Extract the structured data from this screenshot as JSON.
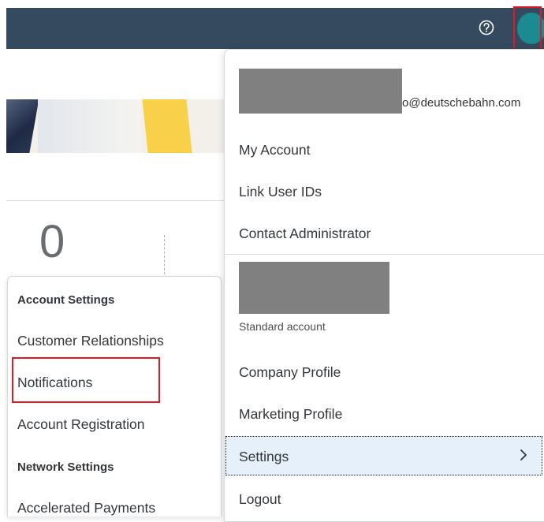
{
  "header": {
    "help_icon": "help-icon",
    "avatar_icon": "user-avatar"
  },
  "dashboard": {
    "count": "0"
  },
  "user_menu": {
    "email_suffix": "o@deutschebahn.com",
    "items_top": [
      "My Account",
      "Link User IDs",
      "Contact Administrator"
    ],
    "account_type": "Standard account",
    "items_bottom": [
      "Company Profile",
      "Marketing Profile",
      "Settings",
      "Logout"
    ],
    "settings_chevron": "chevron-right-icon"
  },
  "settings_submenu": {
    "account_settings_header": "Account Settings",
    "account_items": [
      "Customer Relationships",
      "Notifications",
      "Account Registration"
    ],
    "network_settings_header": "Network Settings",
    "network_items": [
      "Accelerated Payments"
    ]
  },
  "colors": {
    "header_bg": "#354a5f",
    "avatar": "#1b8a91",
    "highlight_border": "#e0181f",
    "selected_row": "#e5f0fa"
  }
}
